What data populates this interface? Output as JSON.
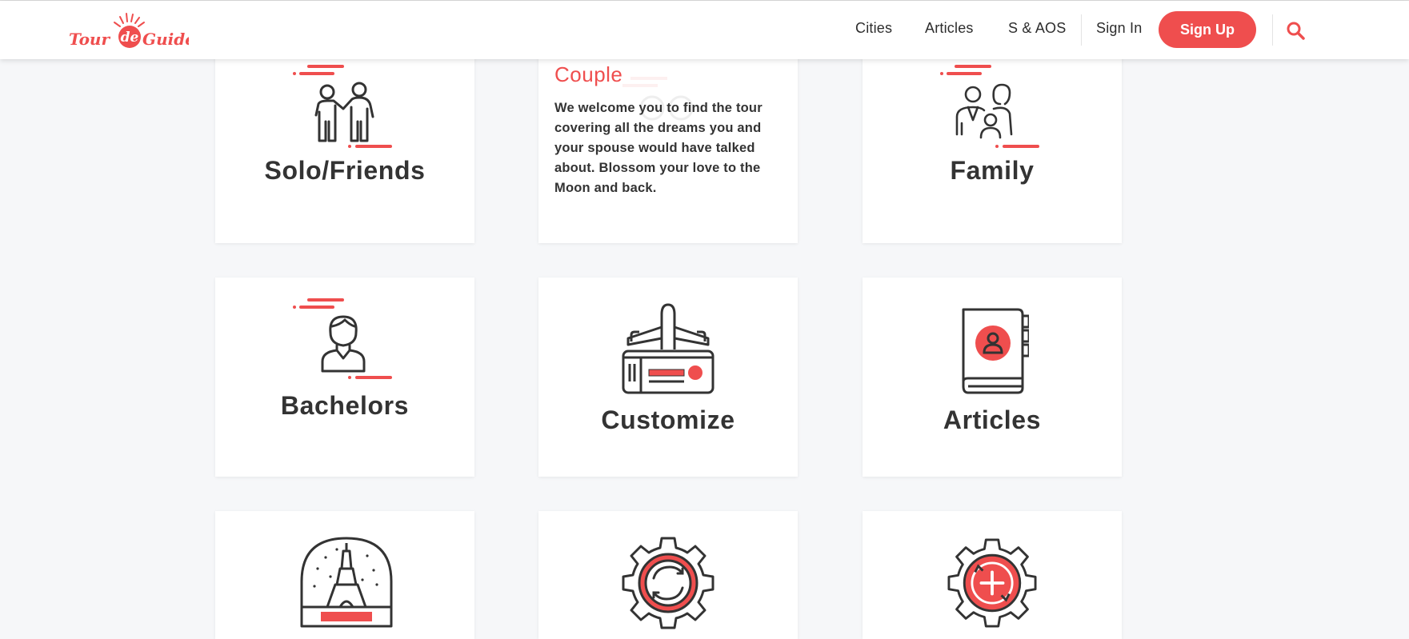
{
  "header": {
    "logo_text": "Tour de Guide",
    "nav": [
      "Cities",
      "Articles",
      "S & AOS",
      "Sign In"
    ],
    "signup_label": "Sign Up",
    "search_icon": "search-icon"
  },
  "colors": {
    "accent": "#ef4e4e",
    "background": "#f6f7f9",
    "card": "#ffffff",
    "text": "#333333"
  },
  "cards": [
    {
      "title": "Solo/Friends",
      "icon": "friends-icon"
    },
    {
      "title": "Couple",
      "description": "We welcome you to find the tour covering all the dreams you and your spouse would have talked about. Blossom your love to the Moon and back.",
      "icon": "couple-icon"
    },
    {
      "title": "Family",
      "icon": "family-icon"
    },
    {
      "title": "Bachelors",
      "icon": "bachelor-icon"
    },
    {
      "title": "Customize",
      "icon": "airplane-ticket-icon"
    },
    {
      "title": "Articles",
      "icon": "address-book-icon"
    },
    {
      "title": "",
      "icon": "eiffel-snow-globe-icon"
    },
    {
      "title": "",
      "icon": "gear-refresh-icon"
    },
    {
      "title": "",
      "icon": "gear-plus-icon"
    }
  ]
}
